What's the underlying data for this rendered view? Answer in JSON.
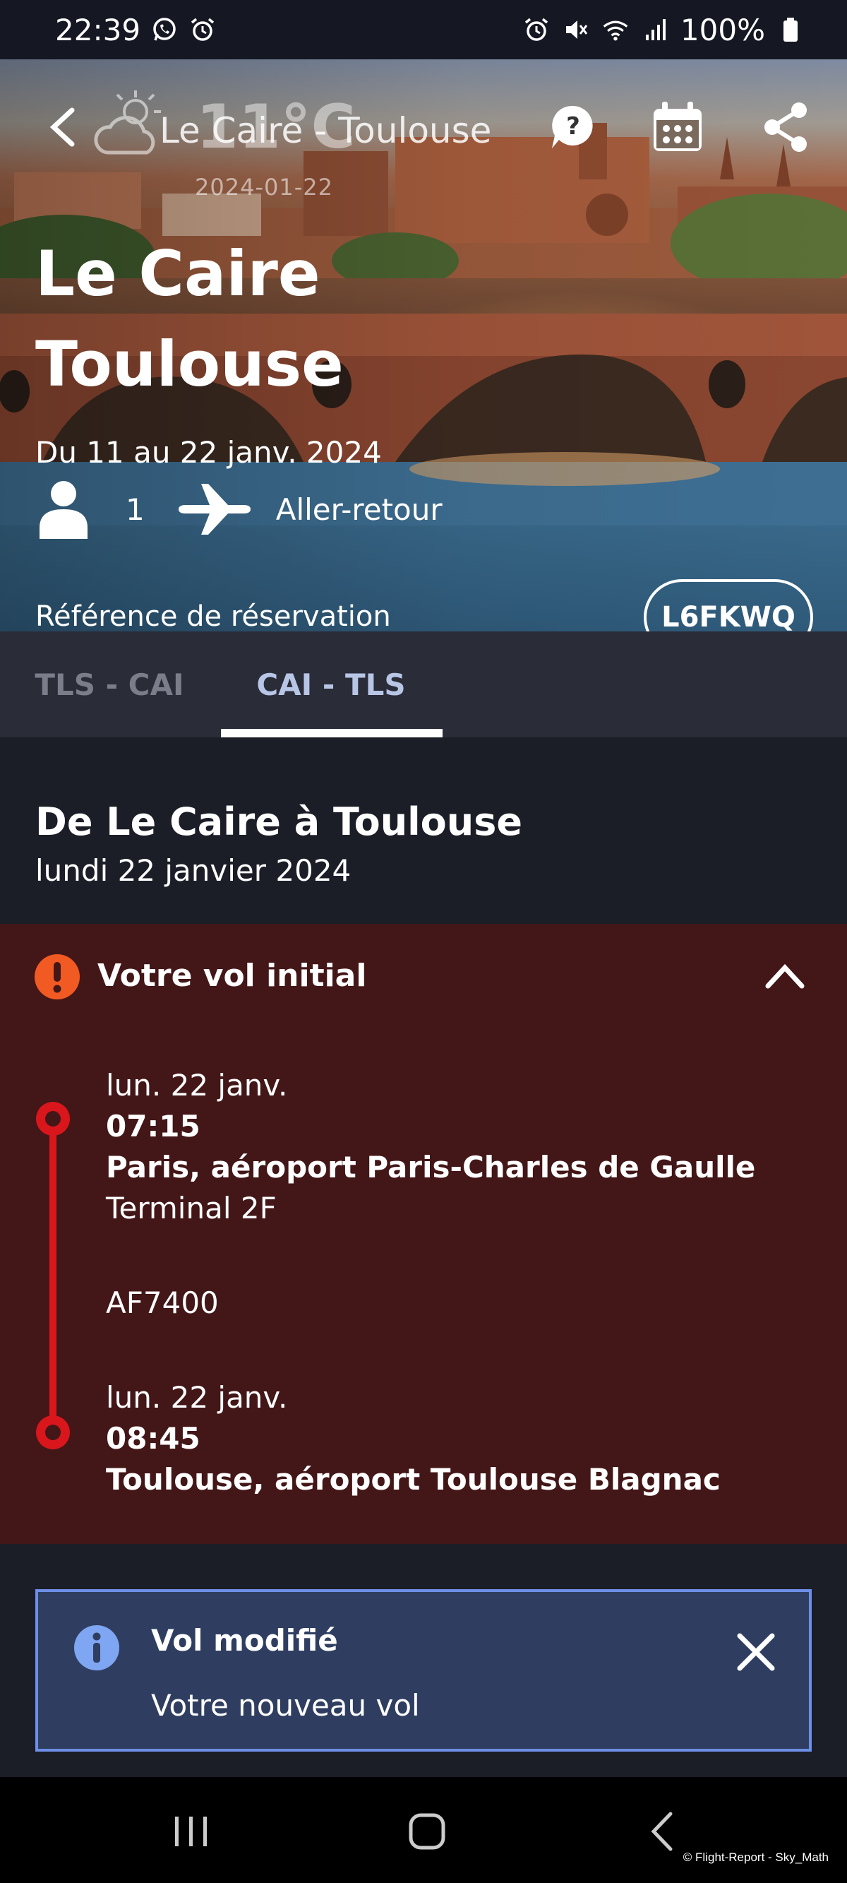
{
  "status_bar": {
    "time": "22:39",
    "battery": "100%",
    "left_icons": [
      "whatsapp-icon",
      "alarm-icon"
    ],
    "right_icons": [
      "alarm-icon",
      "mute-icon",
      "wifi-icon",
      "signal-icon",
      "battery-icon"
    ]
  },
  "header": {
    "route": "Le Caire - Toulouse",
    "weather_temp": "11°C",
    "weather_date": "2024-01-22",
    "weather_icon": "partly-cloudy-icon"
  },
  "hero": {
    "title_line1": "Le Caire",
    "title_line2": "Toulouse",
    "dates": "Du 11 au 22 janv. 2024",
    "passengers": "1",
    "trip_type": "Aller-retour",
    "booking_label": "Référence de réservation",
    "booking_ref": "L6FKWQ"
  },
  "tabs": [
    {
      "label": "TLS - CAI",
      "active": false
    },
    {
      "label": "CAI - TLS",
      "active": true
    }
  ],
  "section": {
    "title": "De Le Caire à Toulouse",
    "date": "lundi 22 janvier 2024"
  },
  "original_flight": {
    "title": "Votre vol initial",
    "departure": {
      "day": "lun. 22 janv.",
      "time": "07:15",
      "airport": "Paris, aéroport Paris-Charles de Gaulle",
      "terminal": "Terminal 2F"
    },
    "flight_number": "AF7400",
    "arrival": {
      "day": "lun. 22 janv.",
      "time": "08:45",
      "airport": "Toulouse, aéroport Toulouse Blagnac"
    }
  },
  "notice": {
    "title": "Vol modifié",
    "text": "Votre nouveau vol"
  },
  "watermark": "© Flight-Report - Sky_Math",
  "colors": {
    "background": "#1b1d27",
    "card_background": "#431617",
    "timeline_red": "#d9161c",
    "alert_orange": "#f15a22",
    "info_background": "#2f3e60",
    "info_border": "#6e8fe8"
  }
}
